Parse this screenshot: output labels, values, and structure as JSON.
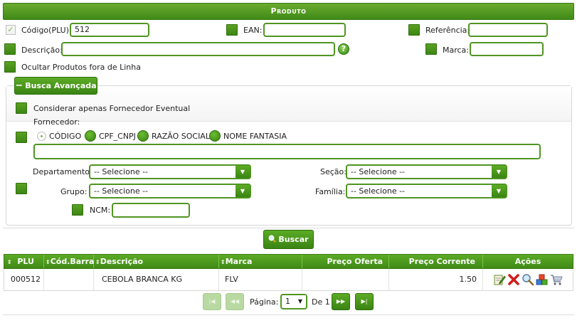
{
  "header": {
    "title": "Produto"
  },
  "filters": {
    "codigo_label": "Código(PLU):",
    "codigo_value": "512",
    "ean_label": "EAN:",
    "ean_value": "",
    "referencia_label": "Referência:",
    "referencia_value": "",
    "descricao_label": "Descrição:",
    "descricao_value": "",
    "marca_label": "Marca:",
    "marca_value": "",
    "help_glyph": "?",
    "ocultar_label": "Ocultar Produtos fora de Linha"
  },
  "advanced": {
    "toggle_label": "Busca Avançada",
    "toggle_glyph": "−",
    "fornecedor_eventual_label": "Considerar apenas Fornecedor Eventual",
    "fornecedor_label": "Fornecedor:",
    "radio_options": [
      "CÓDIGO",
      "CPF_CNPJ",
      "RAZÃO SOCIAL",
      "NOME FANTASIA"
    ],
    "fornecedor_value": "",
    "departamento_label": "Departamento:",
    "departamento_value": "-- Selecione --",
    "secao_label": "Seção:",
    "secao_value": "-- Selecione --",
    "grupo_label": "Grupo:",
    "grupo_value": "-- Selecione --",
    "familia_label": "Família:",
    "familia_value": "-- Selecione --",
    "ncm_label": "NCM:",
    "ncm_value": ""
  },
  "search": {
    "button_label": "Buscar"
  },
  "table": {
    "columns": [
      "PLU",
      "Cód.Barra",
      "Descrição",
      "Marca",
      "Preço Oferta",
      "Preço Corrente",
      "Ações"
    ],
    "rows": [
      {
        "plu": "000512",
        "cod_barra": "",
        "descricao": "CEBOLA BRANCA KG",
        "marca": "FLV",
        "preco_oferta": "",
        "preco_corrente": "1.50"
      }
    ]
  },
  "pagination": {
    "page_label": "Página:",
    "page_value": "1",
    "of_label": "De 1"
  },
  "colors": {
    "primary": "#4f9522",
    "primary_dark": "#3a8414",
    "header_text": "#ffffff"
  }
}
